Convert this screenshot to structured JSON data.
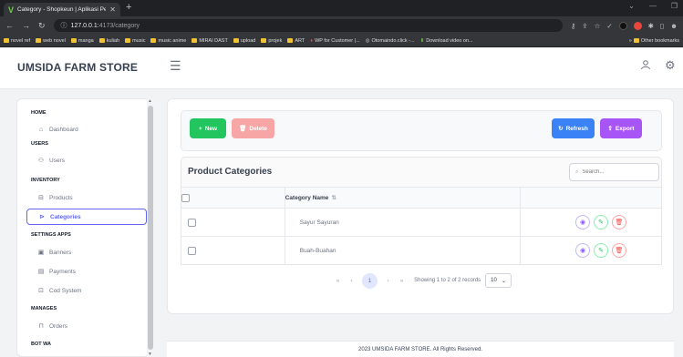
{
  "browser": {
    "tab_title": "Category - Shopkeun | Aplikasi Pe...",
    "tab_favicon": "V",
    "url_host": "127.0.0.1:",
    "url_port_path": "4173/category",
    "bookmarks": [
      "novel ref",
      "web novel",
      "manga",
      "kuliah",
      "music",
      "music anime",
      "MIRAI DAST",
      "upload",
      "projek",
      "ART",
      "WP for Customer |...",
      "Otomaindo.click -...",
      "Download video on..."
    ],
    "other_bookmarks": "Other bookmarks"
  },
  "app": {
    "brand": "UMSIDA FARM STORE"
  },
  "sidebar": {
    "groups": {
      "home": "HOME",
      "users": "USERS",
      "inventory": "INVENTORY",
      "settings": "SETTINGS APPS",
      "manages": "MANAGES",
      "botwa": "BOT WA"
    },
    "items": {
      "dashboard": "Dashboard",
      "users": "Users",
      "products": "Products",
      "categories": "Categories",
      "banners": "Banners",
      "payments": "Payments",
      "cod": "Cod System",
      "orders": "Orders"
    }
  },
  "toolbar": {
    "new_label": "New",
    "delete_label": "Delete",
    "refresh_label": "Refresh",
    "export_label": "Export"
  },
  "table": {
    "title": "Product Categories",
    "search_placeholder": "Search...",
    "column_name": "Category Name",
    "rows": [
      {
        "name": "Sayur Sayuran"
      },
      {
        "name": "Buah-Buahan"
      }
    ]
  },
  "paginator": {
    "current_page": "1",
    "report": "Showing 1 to 2 of 2 records",
    "rows_per_page": "10"
  },
  "footer": {
    "text": "2023 UMSIDA FARM STORE. All Rights Reserved."
  },
  "colors": {
    "new": "#22c55e",
    "delete": "#f8a5a5",
    "refresh": "#3b82f6",
    "export": "#a855f7",
    "active": "#6366f1"
  }
}
